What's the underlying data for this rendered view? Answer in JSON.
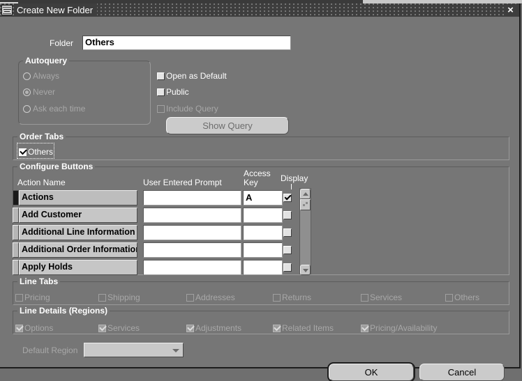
{
  "window": {
    "title": "Create New Folder",
    "close_label": "×",
    "icon": "oracle-forms-icon"
  },
  "folder": {
    "label": "Folder",
    "value": "Others",
    "placeholder": ""
  },
  "autoquery": {
    "legend": "Autoquery",
    "options": [
      {
        "label": "Always",
        "mnemonic": "A",
        "selected": false
      },
      {
        "label": "Never",
        "mnemonic": "N",
        "selected": true
      },
      {
        "label": "Ask each time",
        "mnemonic": "k",
        "selected": false
      }
    ]
  },
  "options": {
    "open_as_default": {
      "label": "Open as Default",
      "checked": false
    },
    "public": {
      "label": "Public",
      "checked": false
    },
    "include_query": {
      "label": "Include Query",
      "checked": false
    },
    "show_query_button": "Show Query"
  },
  "order_tabs": {
    "legend": "Order Tabs",
    "items": [
      {
        "label": "Others",
        "checked": true
      }
    ]
  },
  "configure_buttons": {
    "legend": "Configure Buttons",
    "columns": [
      "Action Name",
      "User Entered Prompt",
      "Access\nKey",
      "Display"
    ],
    "rows": [
      {
        "action_name": "Actions",
        "prompt": "",
        "access_key": "A",
        "display": true,
        "selected": true
      },
      {
        "action_name": "Add Customer",
        "prompt": "",
        "access_key": "",
        "display": false,
        "selected": false
      },
      {
        "action_name": "Additional Line Information",
        "prompt": "",
        "access_key": "",
        "display": false,
        "selected": false
      },
      {
        "action_name": "Additional Order Information",
        "prompt": "",
        "access_key": "",
        "display": false,
        "selected": false
      },
      {
        "action_name": "Apply Holds",
        "prompt": "",
        "access_key": "",
        "display": false,
        "selected": false
      }
    ]
  },
  "line_tabs": {
    "legend": "Line Tabs",
    "items": [
      {
        "label": "Pricing",
        "checked": false
      },
      {
        "label": "Shipping",
        "checked": false
      },
      {
        "label": "Addresses",
        "checked": false
      },
      {
        "label": "Returns",
        "checked": false
      },
      {
        "label": "Services",
        "checked": false
      },
      {
        "label": "Others",
        "checked": false
      }
    ]
  },
  "line_details": {
    "legend": "Line Details (Regions)",
    "items": [
      {
        "label": "Options",
        "checked": true
      },
      {
        "label": "Services",
        "checked": true
      },
      {
        "label": "Adjustments",
        "checked": true
      },
      {
        "label": "Related Items",
        "checked": true
      },
      {
        "label": "Pricing/Availability",
        "checked": true
      }
    ]
  },
  "default_region": {
    "label": "Default Region",
    "value": ""
  },
  "actions": {
    "ok": "OK",
    "cancel": "Cancel"
  }
}
